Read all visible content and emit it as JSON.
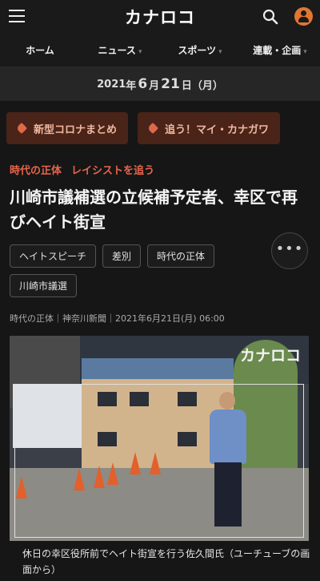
{
  "header": {
    "logo": "カナロコ",
    "icons": [
      "menu-icon",
      "search-icon",
      "account-icon"
    ]
  },
  "nav": {
    "items": [
      {
        "label": "ホーム",
        "chevron": false
      },
      {
        "label": "ニュース",
        "chevron": true
      },
      {
        "label": "スポーツ",
        "chevron": true
      },
      {
        "label": "連載・企画",
        "chevron": true
      }
    ]
  },
  "datebar": {
    "year": "2021",
    "year_suffix": "年",
    "month": "6",
    "month_suffix": "月",
    "day": "21",
    "day_suffix": "日",
    "weekday": "（月）"
  },
  "top_tags": [
    "新型コロナまとめ",
    "追う！マイ・カナガワ"
  ],
  "article": {
    "category": [
      "時代の正体",
      "レイシストを追う"
    ],
    "title": "川崎市議補選の立候補予定者、幸区で再びヘイト街宣",
    "keywords": [
      "ヘイトスピーチ",
      "差別",
      "時代の正体",
      "川崎市議選"
    ],
    "more_label": "•••",
    "meta": "時代の正体｜神奈川新聞｜2021年6月21日(月) 06:00",
    "photo_logo": "カナロコ",
    "caption": "休日の幸区役所前でヘイト街宣を行う佐久間氏（ユーチューブの画面から）"
  },
  "colors": {
    "accent": "#e8644b",
    "pill_bg": "#4a2418",
    "pill_text": "#f1b8a0",
    "background": "#161616"
  }
}
